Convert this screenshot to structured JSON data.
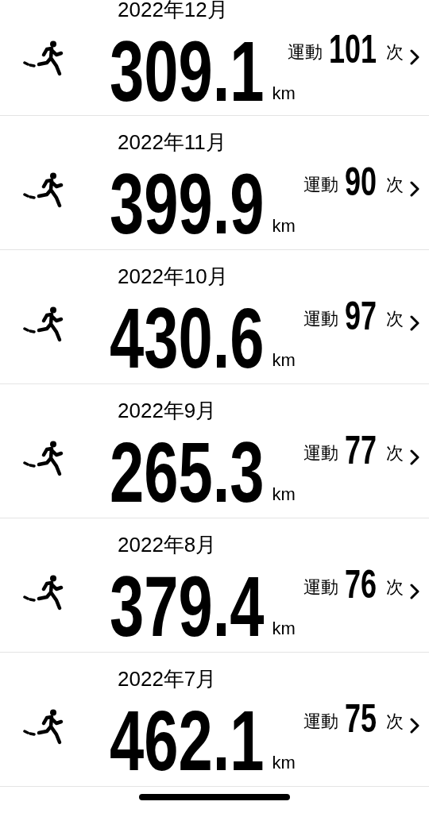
{
  "months": [
    {
      "month": "2022年12月",
      "distance": "309.1",
      "unit": "km",
      "count_label": "運動",
      "count": "101",
      "count_unit": "次"
    },
    {
      "month": "2022年11月",
      "distance": "399.9",
      "unit": "km",
      "count_label": "運動",
      "count": "90",
      "count_unit": "次"
    },
    {
      "month": "2022年10月",
      "distance": "430.6",
      "unit": "km",
      "count_label": "運動",
      "count": "97",
      "count_unit": "次"
    },
    {
      "month": "2022年9月",
      "distance": "265.3",
      "unit": "km",
      "count_label": "運動",
      "count": "77",
      "count_unit": "次"
    },
    {
      "month": "2022年8月",
      "distance": "379.4",
      "unit": "km",
      "count_label": "運動",
      "count": "76",
      "count_unit": "次"
    },
    {
      "month": "2022年7月",
      "distance": "462.1",
      "unit": "km",
      "count_label": "運動",
      "count": "75",
      "count_unit": "次"
    }
  ]
}
